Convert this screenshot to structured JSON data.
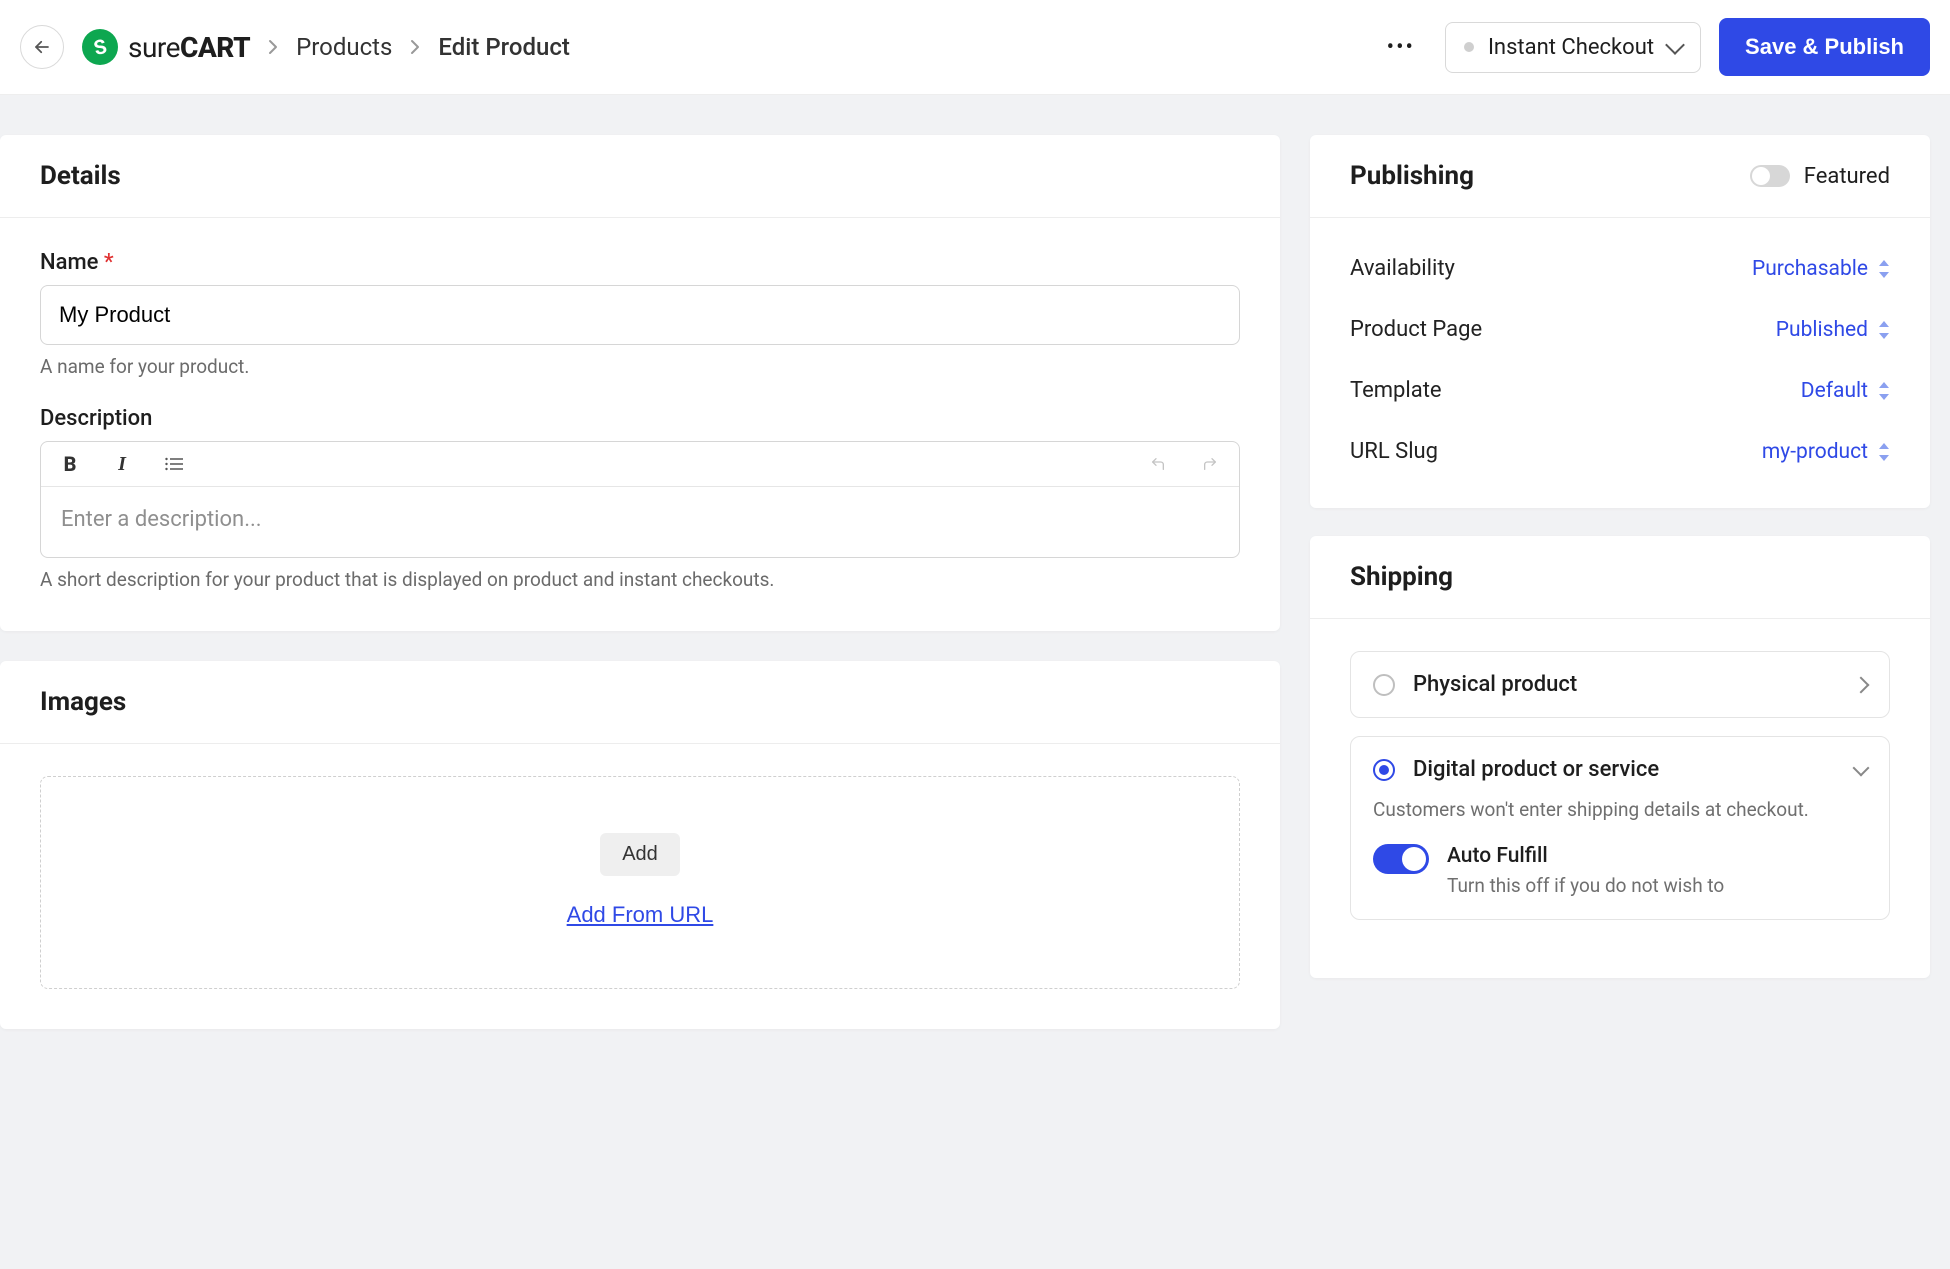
{
  "header": {
    "brand_prefix": "sure",
    "brand_bold": "CART",
    "breadcrumb_parent": "Products",
    "breadcrumb_current": "Edit Product",
    "instant_checkout_label": "Instant Checkout",
    "save_label": "Save & Publish"
  },
  "details": {
    "section_title": "Details",
    "name_label": "Name",
    "name_value": "My Product",
    "name_help": "A name for your product.",
    "description_label": "Description",
    "description_placeholder": "Enter a description...",
    "description_help": "A short description for your product that is displayed on product and instant checkouts."
  },
  "images": {
    "section_title": "Images",
    "add_label": "Add",
    "add_url_label": "Add From URL"
  },
  "publishing": {
    "section_title": "Publishing",
    "featured_label": "Featured",
    "rows": {
      "availability_label": "Availability",
      "availability_value": "Purchasable",
      "page_label": "Product Page",
      "page_value": "Published",
      "template_label": "Template",
      "template_value": "Default",
      "slug_label": "URL Slug",
      "slug_value": "my-product"
    }
  },
  "shipping": {
    "section_title": "Shipping",
    "physical_label": "Physical product",
    "digital_label": "Digital product or service",
    "digital_desc": "Customers won't enter shipping details at checkout.",
    "auto_fulfill_title": "Auto Fulfill",
    "auto_fulfill_desc": "Turn this off if you do not wish to"
  }
}
